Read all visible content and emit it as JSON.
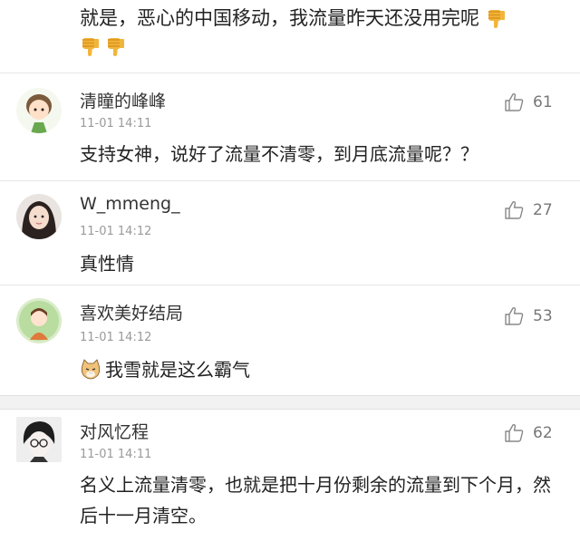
{
  "top_comment": {
    "text": "就是，恶心的中国移动，我流量昨天还没用完呢"
  },
  "comments": [
    {
      "username": "清瞳的峰峰",
      "timestamp": "11-01 14:11",
      "likes": "61",
      "content": "支持女神，说好了流量不清零，到月底流量呢？？"
    },
    {
      "username": "W_mmeng_",
      "timestamp": "11-01 14:12",
      "likes": "27",
      "content": "真性情"
    },
    {
      "username": "喜欢美好结局",
      "timestamp": "11-01 14:12",
      "likes": "53",
      "content": "我雪就是这么霸气"
    },
    {
      "username": "对风忆程",
      "timestamp": "11-01 14:11",
      "likes": "62",
      "content": "名义上流量清零，也就是把十月份剩余的流量到下个月，然后十一月清空。"
    }
  ],
  "icons": {
    "like": "thumbs-up-outline-icon",
    "dislike_emoji": "thumbs-down-emoji-icon",
    "cat_emoji": "cat-face-emoji-icon"
  }
}
